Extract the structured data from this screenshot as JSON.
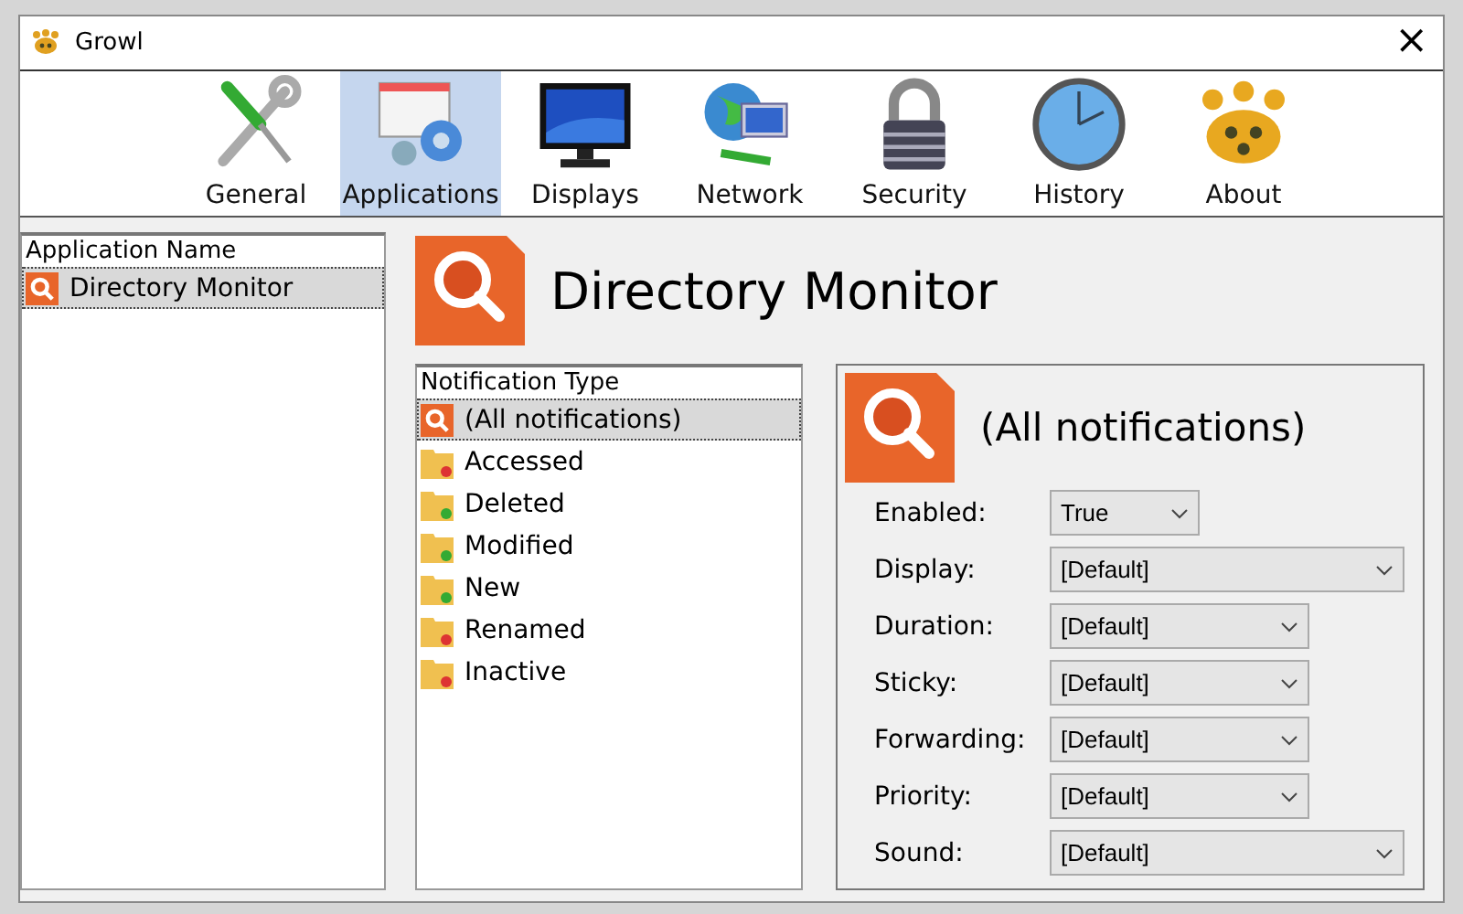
{
  "window": {
    "title": "Growl",
    "close": "×"
  },
  "tabs": [
    {
      "label": "General",
      "selected": false
    },
    {
      "label": "Applications",
      "selected": true
    },
    {
      "label": "Displays",
      "selected": false
    },
    {
      "label": "Network",
      "selected": false
    },
    {
      "label": "Security",
      "selected": false
    },
    {
      "label": "History",
      "selected": false
    },
    {
      "label": "About",
      "selected": false
    }
  ],
  "applications": {
    "header": "Application Name",
    "items": [
      {
        "name": "Directory Monitor",
        "selected": true
      }
    ]
  },
  "app_title": "Directory Monitor",
  "notifications": {
    "header": "Notification Type",
    "items": [
      {
        "name": "(All notifications)",
        "kind": "app",
        "selected": true
      },
      {
        "name": "Accessed",
        "kind": "folder",
        "selected": false
      },
      {
        "name": "Deleted",
        "kind": "folder",
        "selected": false
      },
      {
        "name": "Modified",
        "kind": "folder",
        "selected": false
      },
      {
        "name": "New",
        "kind": "folder",
        "selected": false
      },
      {
        "name": "Renamed",
        "kind": "folder",
        "selected": false
      },
      {
        "name": "Inactive",
        "kind": "folder",
        "selected": false
      }
    ]
  },
  "details": {
    "title": "(All notifications)",
    "settings": [
      {
        "label": "Enabled:",
        "value": "True",
        "kind": "small"
      },
      {
        "label": "Display:",
        "value": "[Default]",
        "kind": "wide"
      },
      {
        "label": "Duration:",
        "value": "[Default]",
        "kind": "medium"
      },
      {
        "label": "Sticky:",
        "value": "[Default]",
        "kind": "medium"
      },
      {
        "label": "Forwarding:",
        "value": "[Default]",
        "kind": "medium"
      },
      {
        "label": "Priority:",
        "value": "[Default]",
        "kind": "medium"
      },
      {
        "label": "Sound:",
        "value": "[Default]",
        "kind": "wide"
      }
    ]
  }
}
